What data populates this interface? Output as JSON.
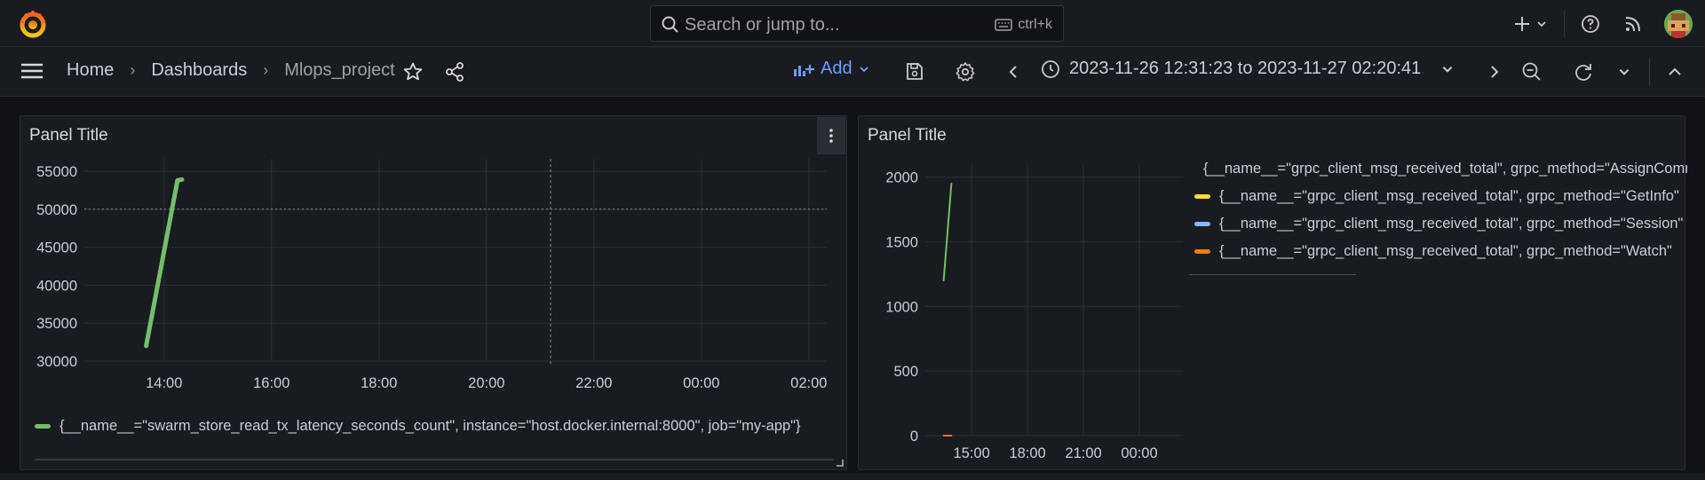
{
  "topbar": {
    "search_placeholder": "Search or jump to...",
    "search_shortcut": "ctrl+k"
  },
  "breadcrumb": {
    "home": "Home",
    "dashboards": "Dashboards",
    "current": "Mlops_project"
  },
  "toolbar": {
    "add_label": "Add",
    "time_range": "2023-11-26 12:31:23 to 2023-11-27 02:20:41"
  },
  "panels": [
    {
      "title": "Panel Title",
      "legend": [
        {
          "label": "{__name__=\"swarm_store_read_tx_latency_seconds_count\", instance=\"host.docker.internal:8000\", job=\"my-app\"}",
          "color": "#73bf69"
        }
      ]
    },
    {
      "title": "Panel Title",
      "legend": [
        {
          "label": "{__name__=\"grpc_client_msg_received_total\", grpc_method=\"AssignCommand\"",
          "color": "#73bf69"
        },
        {
          "label": "{__name__=\"grpc_client_msg_received_total\", grpc_method=\"GetInfo\"",
          "color": "#fade2a"
        },
        {
          "label": "{__name__=\"grpc_client_msg_received_total\", grpc_method=\"Session\"",
          "color": "#8ab8ff"
        },
        {
          "label": "{__name__=\"grpc_client_msg_received_total\", grpc_method=\"Watch\"",
          "color": "#ff780a"
        }
      ]
    }
  ],
  "chart_data": [
    {
      "type": "line",
      "title": "Panel Title",
      "x_ticks": [
        "14:00",
        "16:00",
        "18:00",
        "20:00",
        "22:00",
        "00:00",
        "02:00"
      ],
      "y_ticks": [
        "30000",
        "35000",
        "40000",
        "45000",
        "50000",
        "55000"
      ],
      "ylim": [
        30000,
        55000
      ],
      "threshold_line": 50000,
      "series": [
        {
          "name": "{__name__=\"swarm_store_read_tx_latency_seconds_count\", instance=\"host.docker.internal:8000\", job=\"my-app\"}",
          "color": "#73bf69",
          "points": [
            [
              "13:40",
              32000
            ],
            [
              "14:15",
              53800
            ],
            [
              "14:20",
              53900
            ]
          ]
        }
      ]
    },
    {
      "type": "line",
      "title": "Panel Title",
      "x_ticks": [
        "15:00",
        "18:00",
        "21:00",
        "00:00"
      ],
      "y_ticks": [
        "0",
        "500",
        "1000",
        "1500",
        "2000"
      ],
      "ylim": [
        0,
        2100
      ],
      "series": [
        {
          "name": "AssignCommand",
          "color": "#73bf69",
          "points": [
            [
              "13:30",
              1200
            ],
            [
              "13:55",
              1950
            ]
          ]
        },
        {
          "name": "Watch",
          "color": "#ff780a",
          "points": [
            [
              "13:30",
              0
            ],
            [
              "13:55",
              0
            ]
          ]
        }
      ]
    }
  ]
}
